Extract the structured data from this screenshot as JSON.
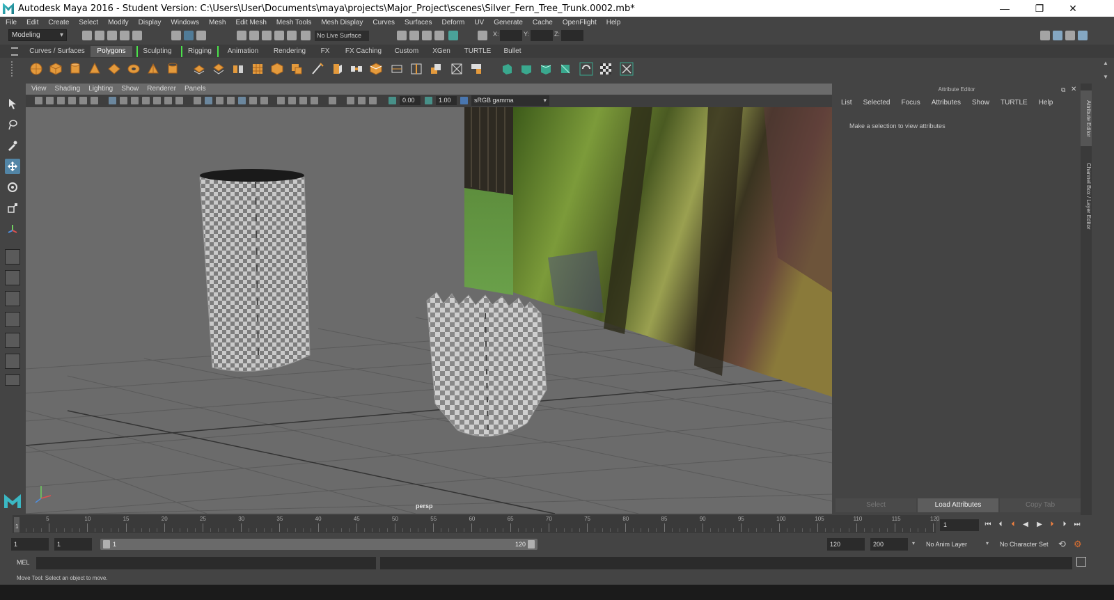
{
  "window": {
    "title": "Autodesk Maya 2016 - Student Version: C:\\Users\\User\\Documents\\maya\\projects\\Major_Project\\scenes\\Silver_Fern_Tree_Trunk.0002.mb*",
    "minimize": "—",
    "restore": "❐",
    "close": "✕"
  },
  "menubar": [
    "File",
    "Edit",
    "Create",
    "Select",
    "Modify",
    "Display",
    "Windows",
    "Mesh",
    "Edit Mesh",
    "Mesh Tools",
    "Mesh Display",
    "Curves",
    "Surfaces",
    "Deform",
    "UV",
    "Generate",
    "Cache",
    "OpenFlight",
    "Help"
  ],
  "statusline": {
    "mode": "Modeling",
    "live_surface": "No Live Surface",
    "x_label": "X:",
    "y_label": "Y:",
    "z_label": "Z:"
  },
  "shelf_tabs": {
    "items": [
      "Curves / Surfaces",
      "Polygons",
      "Sculpting",
      "Rigging",
      "Animation",
      "Rendering",
      "FX",
      "FX Caching",
      "Custom",
      "XGen",
      "TURTLE",
      "Bullet"
    ],
    "active": "Polygons"
  },
  "viewport": {
    "menu": [
      "View",
      "Shading",
      "Lighting",
      "Show",
      "Renderer",
      "Panels"
    ],
    "field_a": "0.00",
    "field_b": "1.00",
    "color_space": "sRGB gamma",
    "camera": "persp"
  },
  "attribute_editor": {
    "title": "Attribute Editor",
    "menu": [
      "List",
      "Selected",
      "Focus",
      "Attributes",
      "Show",
      "TURTLE",
      "Help"
    ],
    "message": "Make a selection to view attributes",
    "btn_select": "Select",
    "btn_load": "Load Attributes",
    "btn_copy": "Copy Tab"
  },
  "side_tabs": [
    "Attribute Editor",
    "Channel Box / Layer Editor"
  ],
  "timeline": {
    "ticks": [
      "5",
      "10",
      "15",
      "20",
      "25",
      "30",
      "35",
      "40",
      "45",
      "50",
      "55",
      "60",
      "65",
      "70",
      "75",
      "80",
      "85",
      "90",
      "95",
      "100",
      "105",
      "110",
      "115",
      "120"
    ],
    "start_mark": "1",
    "current_frame": "1"
  },
  "range": {
    "start": "1",
    "playback_start": "1",
    "range_start_label": "1",
    "range_end_label": "120",
    "playback_end": "120",
    "end": "200",
    "anim_layer": "No Anim Layer",
    "character_set": "No Character Set"
  },
  "command": {
    "language": "MEL"
  },
  "helpline": {
    "text": "Move Tool: Select an object to move."
  }
}
